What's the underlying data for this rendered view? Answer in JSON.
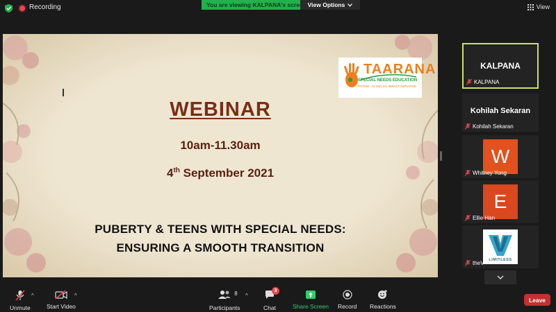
{
  "topbar": {
    "recording_label": "Recording",
    "viewing_banner": "You are viewing KALPANA's screen",
    "view_options_label": "View Options",
    "view_label": "View"
  },
  "slide": {
    "title": "WEBINAR",
    "time": "10am-11.30am",
    "date_day": "4",
    "date_suffix": "th",
    "date_rest": " September 2021",
    "topic_line1": "PUBERTY & TEENS WITH SPECIAL NEEDS:",
    "topic_line2": "ENSURING A SMOOTH TRANSITION",
    "logo": {
      "brand": "TAARANA",
      "subtitle": "SPECIAL NEEDS EDUCATION",
      "tagline": "RYTHM - GI SOCIAL IMPACT INITIATIVE"
    }
  },
  "participants": [
    {
      "display": "KALPANA",
      "name": "KALPANA",
      "avatar_letter": "",
      "active": true
    },
    {
      "display": "Kohilah Sekaran",
      "name": "Kohilah Sekaran",
      "avatar_letter": ""
    },
    {
      "display": "",
      "name": "Whitney Yong",
      "avatar_letter": "W",
      "avatar_color": "#e2511f"
    },
    {
      "display": "",
      "name": "Ellie Han",
      "avatar_letter": "E",
      "avatar_color": "#d9481f"
    },
    {
      "display": "",
      "name": "theV",
      "avatar_letter": "",
      "logo_text": "LIMITLESS"
    }
  ],
  "toolbar": {
    "unmute_label": "Unmute",
    "start_video_label": "Start Video",
    "participants_label": "Participants",
    "participants_count": "8",
    "chat_label": "Chat",
    "chat_badge": "3",
    "share_screen_label": "Share Screen",
    "record_label": "Record",
    "reactions_label": "Reactions",
    "leave_label": "Leave"
  },
  "colors": {
    "accent_green": "#22b14c",
    "active_border": "#c9e265",
    "leave_red": "#c62f2f",
    "slide_title": "#7a2d16"
  }
}
